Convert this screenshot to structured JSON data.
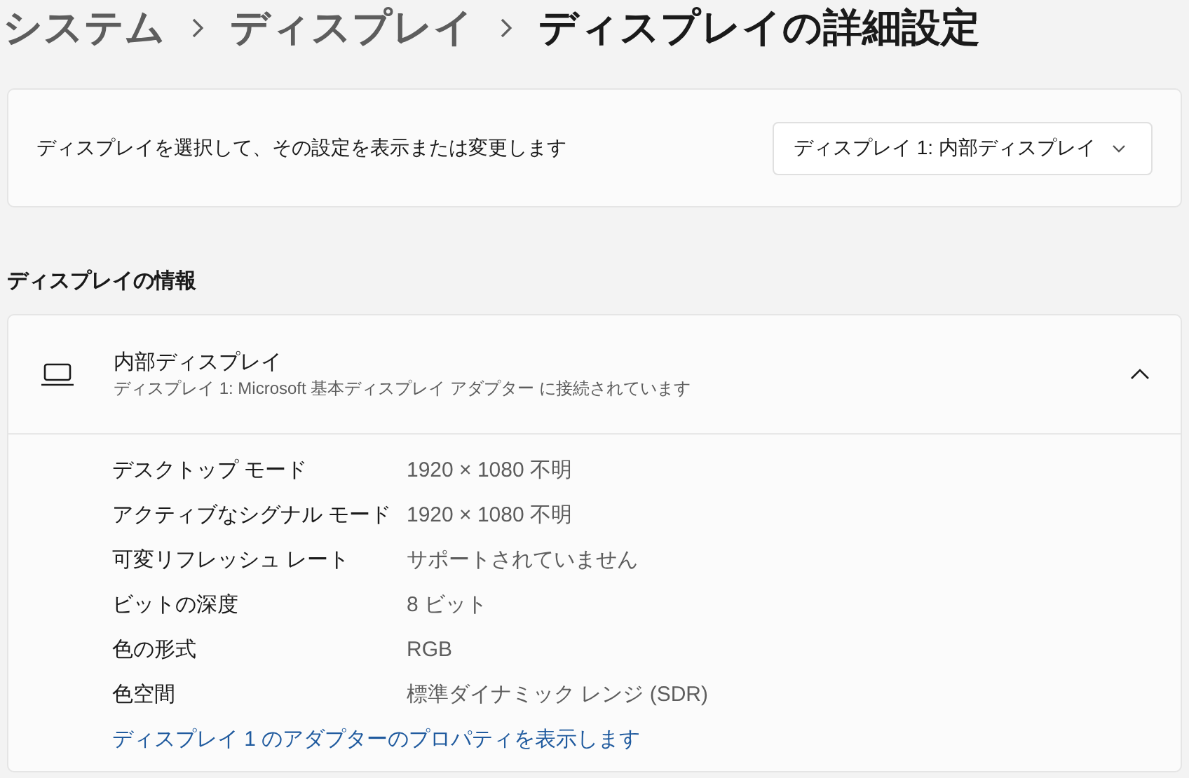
{
  "breadcrumb": [
    {
      "label": "システム",
      "selected": false
    },
    {
      "label": "ディスプレイ",
      "selected": false
    },
    {
      "label": "ディスプレイの詳細設定",
      "selected": true
    }
  ],
  "select_display": {
    "label": "ディスプレイを選択して、その設定を表示または変更します",
    "value": "ディスプレイ 1: 内部ディスプレイ"
  },
  "section_title": "ディスプレイの情報",
  "display_info": {
    "title": "内部ディスプレイ",
    "subtitle": "ディスプレイ 1: Microsoft 基本ディスプレイ アダプター に接続されています",
    "expanded": true,
    "rows": [
      {
        "label": "デスクトップ モード",
        "value": "1920 × 1080 不明"
      },
      {
        "label": "アクティブなシグナル モード",
        "value": "1920 × 1080 不明"
      },
      {
        "label": "可変リフレッシュ レート",
        "value": "サポートされていません"
      },
      {
        "label": "ビットの深度",
        "value": "8 ビット"
      },
      {
        "label": "色の形式",
        "value": "RGB"
      },
      {
        "label": "色空間",
        "value": "標準ダイナミック レンジ (SDR)"
      }
    ],
    "link": "ディスプレイ 1 のアダプターのプロパティを表示します"
  }
}
